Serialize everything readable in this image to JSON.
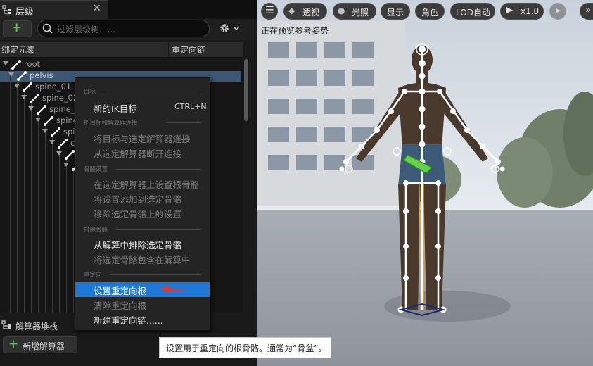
{
  "tab": {
    "title": "层级"
  },
  "search": {
    "placeholder": "过滤层级树......"
  },
  "columns": {
    "col1": "绑定元素",
    "col2": "重定向链"
  },
  "tree": [
    "root",
    "pelvis",
    "spine_01",
    "spine_02",
    "spine_",
    "spine",
    "spi",
    "c"
  ],
  "solver": {
    "title": "解算器堆栈",
    "add_label": "新增解算器"
  },
  "viewport": {
    "toolbar": {
      "perspective": "透视",
      "lighting": "光照",
      "show": "显示",
      "role": "角色",
      "lod": "LOD自动",
      "speed": "x1.0"
    },
    "preview_text": "正在预览参考姿势"
  },
  "menu": {
    "sec1": "目标",
    "new_ik": "新的IK目标",
    "shortcut": "CTRL+N",
    "sec2": "把目标和解算器连接",
    "connect": "将目标与选定解算器连接",
    "disconnect": "从选定解算器断开连接",
    "sec3": "骨骼设置",
    "set_root": "在选定解算器上设置根骨骼",
    "add_setting": "将设置添加到选定骨骼",
    "remove_setting": "移除选定骨骼上的设置",
    "sec4": "排除骨骼",
    "exclude": "从解算中排除选定骨骼",
    "include": "将选定骨骼包含在解算中",
    "sec5": "重定向",
    "set_retarget_root": "设置重定向根",
    "clear_retarget_root": "清除重定向根",
    "new_chain": "新建重定向链......"
  },
  "tooltip": "设置用于重定向的根骨骼。通常为“骨盆”。",
  "colors": {
    "accent": "#1e78d6",
    "selection": "#3d5673",
    "add_green": "#5fc35f",
    "arrow_red": "#e03a2a"
  }
}
